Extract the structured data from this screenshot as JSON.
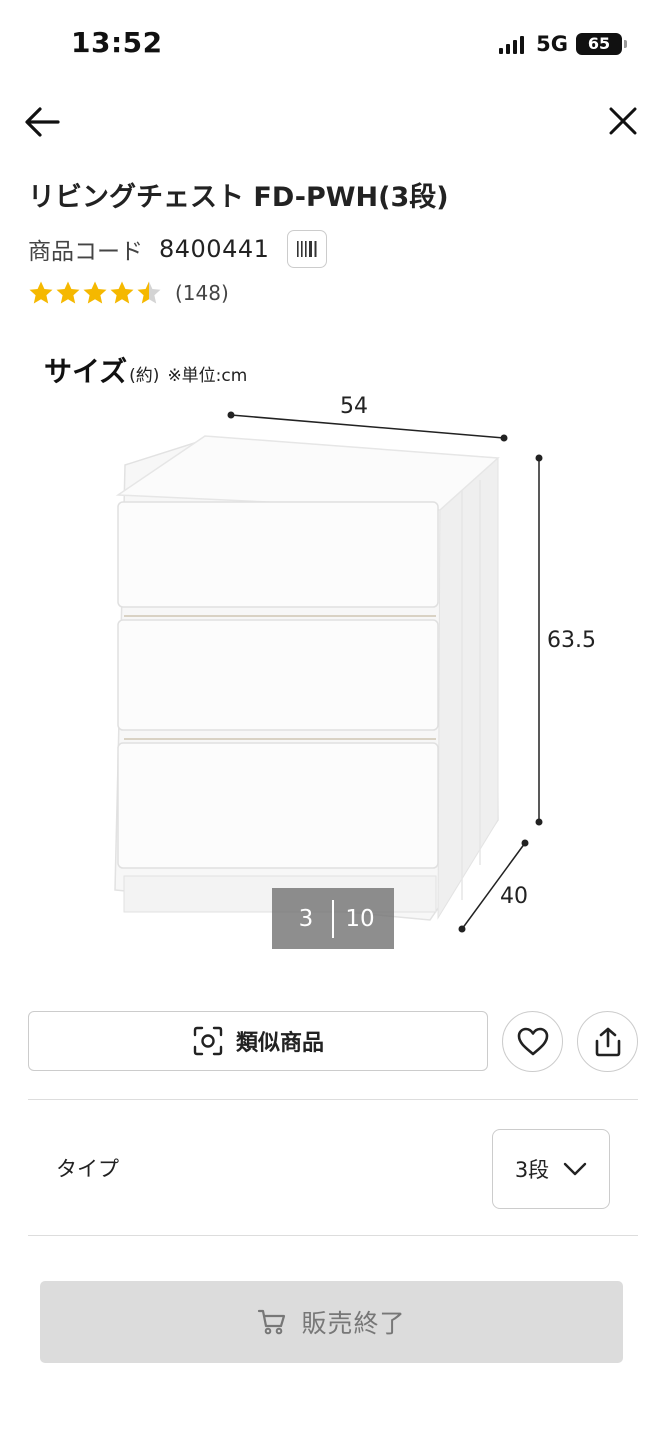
{
  "status_bar": {
    "time": "13:52",
    "network": "5G",
    "battery": "65"
  },
  "product": {
    "title": "リビングチェスト FD-PWH(3段)",
    "code_label": "商品コード",
    "code_value": "8400441",
    "rating": 4.5,
    "review_count": "(148)"
  },
  "image": {
    "size_title": "サイズ",
    "size_approx": "(約)",
    "size_note": "※単位:cm",
    "width": "54",
    "height": "63.5",
    "depth": "40",
    "pager_current": "3",
    "pager_total": "10"
  },
  "actions": {
    "similar_label": "類似商品"
  },
  "type": {
    "label": "タイプ",
    "value": "3段"
  },
  "purchase": {
    "sold_out_label": "販売終了"
  },
  "colors": {
    "star": "#f5b800",
    "sold_out_bg": "#dcdcdc"
  }
}
